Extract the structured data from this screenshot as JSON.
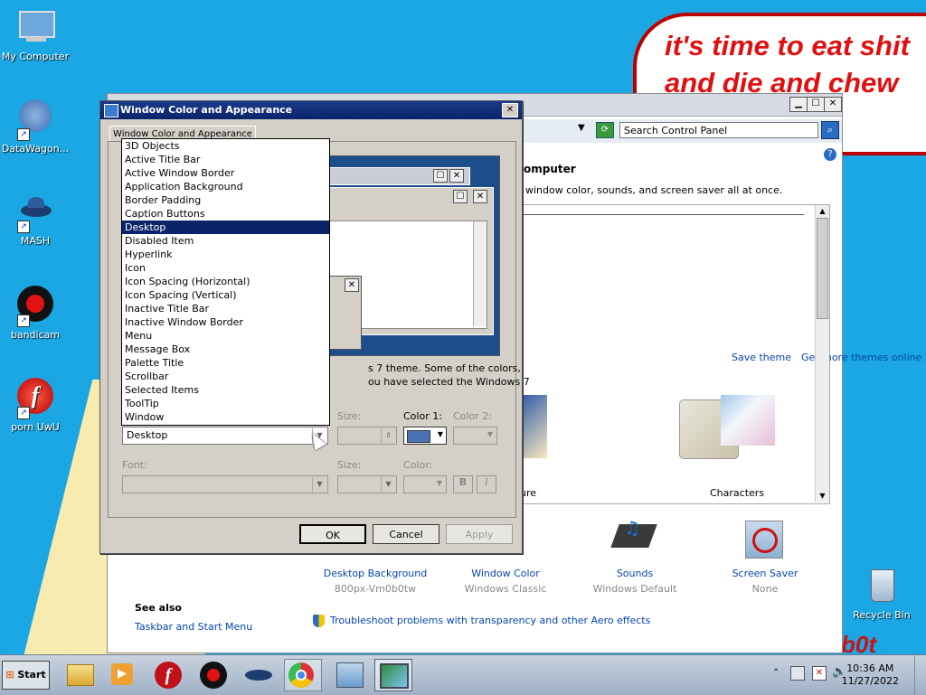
{
  "desktop": {
    "icons": [
      {
        "label": "My Computer"
      },
      {
        "label": "DataWagon..."
      },
      {
        "label": "MASH"
      },
      {
        "label": "bandicam"
      },
      {
        "label": "porn UwU"
      },
      {
        "label": "Recycle Bin"
      }
    ],
    "bubble_text_line1": "it's time to eat shit",
    "bubble_text_line2": "and die and chew",
    "corner_text": "b0t"
  },
  "control_panel": {
    "search_placeholder": "Search Control Panel",
    "heading_fragment": "omputer",
    "subheading_fragment": ", window color, sounds, and screen saver all at once.",
    "save_theme": "Save theme",
    "get_more_themes": "Get more themes online",
    "theme_fragment_label": "ure",
    "theme_characters": "Characters",
    "bottom_items": [
      {
        "label": "Desktop Background",
        "sub": "800px-Vm0b0tw"
      },
      {
        "label": "Window Color",
        "sub": "Windows Classic"
      },
      {
        "label": "Sounds",
        "sub": "Windows Default"
      },
      {
        "label": "Screen Saver",
        "sub": "None"
      }
    ],
    "see_also": "See also",
    "taskbar_link": "Taskbar and Start Menu",
    "troubleshoot_link": "Troubleshoot problems with transparency and other Aero effects"
  },
  "dialog": {
    "title": "Window Color and Appearance",
    "tab_label": "Window Color and Appearance",
    "desc_line1": "s 7 theme.  Some of the colors,",
    "desc_line2": "ou have selected the Windows 7",
    "item_selected": "Desktop",
    "size_label": "Size:",
    "color1_label": "Color 1:",
    "color2_label": "Color 2:",
    "font_label": "Font:",
    "font_size_label": "Size:",
    "font_color_label": "Color:",
    "bold_label": "B",
    "italic_label": "I",
    "ok": "OK",
    "cancel": "Cancel",
    "apply": "Apply",
    "color1_value": "#4a73b5",
    "dropdown_options": [
      "3D Objects",
      "Active Title Bar",
      "Active Window Border",
      "Application Background",
      "Border Padding",
      "Caption Buttons",
      "Desktop",
      "Disabled Item",
      "Hyperlink",
      "Icon",
      "Icon Spacing (Horizontal)",
      "Icon Spacing (Vertical)",
      "Inactive Title Bar",
      "Inactive Window Border",
      "Menu",
      "Message Box",
      "Palette Title",
      "Scrollbar",
      "Selected Items",
      "ToolTip",
      "Window"
    ],
    "selected_index": 6
  },
  "taskbar": {
    "start_label": "Start",
    "time": "10:36 AM",
    "date": "11/27/2022"
  }
}
